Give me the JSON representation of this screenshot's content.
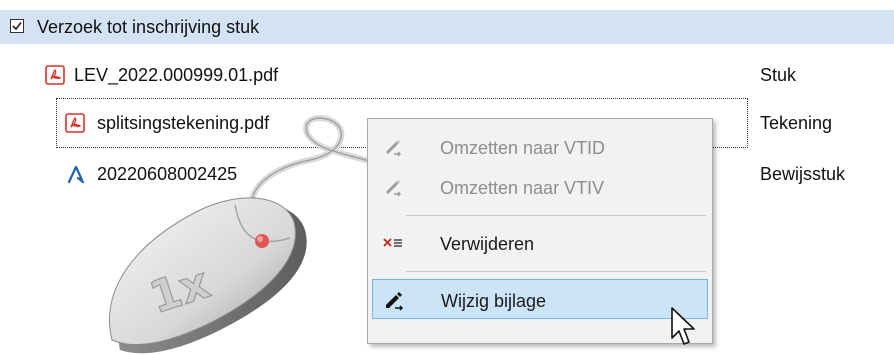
{
  "header": {
    "label": "Verzoek tot inschrijving stuk",
    "checked": true
  },
  "rows": [
    {
      "name": "LEV_2022.000999.01.pdf",
      "type": "Stuk",
      "icon": "pdf-icon"
    },
    {
      "name": "splitsingstekening.pdf",
      "type": "Tekening",
      "icon": "pdf-icon"
    },
    {
      "name": "20220608002425",
      "type": "Bewijsstuk",
      "icon": "signature-icon"
    }
  ],
  "context_menu": {
    "items": [
      {
        "label": "Omzetten naar VTID",
        "enabled": false,
        "icon": "convert-icon"
      },
      {
        "label": "Omzetten naar VTIV",
        "enabled": false,
        "icon": "convert-icon"
      },
      {
        "label": "Verwijderen",
        "enabled": true,
        "icon": "delete-list-icon"
      },
      {
        "label": "Wijzig bijlage",
        "enabled": true,
        "highlighted": true,
        "icon": "edit-pen-icon"
      }
    ]
  },
  "overlay": {
    "click_count_label": "1x"
  },
  "colors": {
    "header_bg": "#d4e3f4",
    "menu_bg": "#f2f2f2",
    "highlight_bg": "#cce4f7",
    "pdf_red": "#d9332b",
    "signature_blue": "#1f5fb0",
    "delete_red": "#cc2222"
  }
}
